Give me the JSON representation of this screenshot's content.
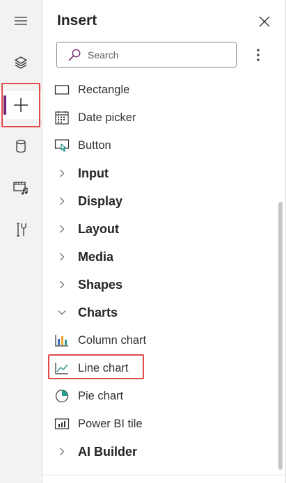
{
  "rail": {
    "items": [
      {
        "icon": "hamburger-menu-icon"
      },
      {
        "icon": "layers-icon"
      },
      {
        "icon": "plus-icon",
        "active": true
      },
      {
        "icon": "database-icon"
      },
      {
        "icon": "media-icon"
      },
      {
        "icon": "tools-icon"
      }
    ],
    "accent_color": "#742774",
    "highlight_color": "#e04a4a"
  },
  "panel": {
    "title": "Insert",
    "search": {
      "placeholder": "Search",
      "value": ""
    }
  },
  "list": {
    "items": [
      {
        "type": "control",
        "label": "Rectangle",
        "icon": "rectangle-icon"
      },
      {
        "type": "control",
        "label": "Date picker",
        "icon": "calendar-icon"
      },
      {
        "type": "control",
        "label": "Button",
        "icon": "button-icon"
      },
      {
        "type": "category",
        "label": "Input",
        "expanded": false
      },
      {
        "type": "category",
        "label": "Display",
        "expanded": false
      },
      {
        "type": "category",
        "label": "Layout",
        "expanded": false
      },
      {
        "type": "category",
        "label": "Media",
        "expanded": false
      },
      {
        "type": "category",
        "label": "Shapes",
        "expanded": false
      },
      {
        "type": "category",
        "label": "Charts",
        "expanded": true
      },
      {
        "type": "control",
        "label": "Column chart",
        "icon": "column-chart-icon"
      },
      {
        "type": "control",
        "label": "Line chart",
        "icon": "line-chart-icon",
        "highlighted": true
      },
      {
        "type": "control",
        "label": "Pie chart",
        "icon": "pie-chart-icon"
      },
      {
        "type": "control",
        "label": "Power BI tile",
        "icon": "power-bi-icon"
      },
      {
        "type": "category",
        "label": "AI Builder",
        "expanded": false
      }
    ]
  }
}
